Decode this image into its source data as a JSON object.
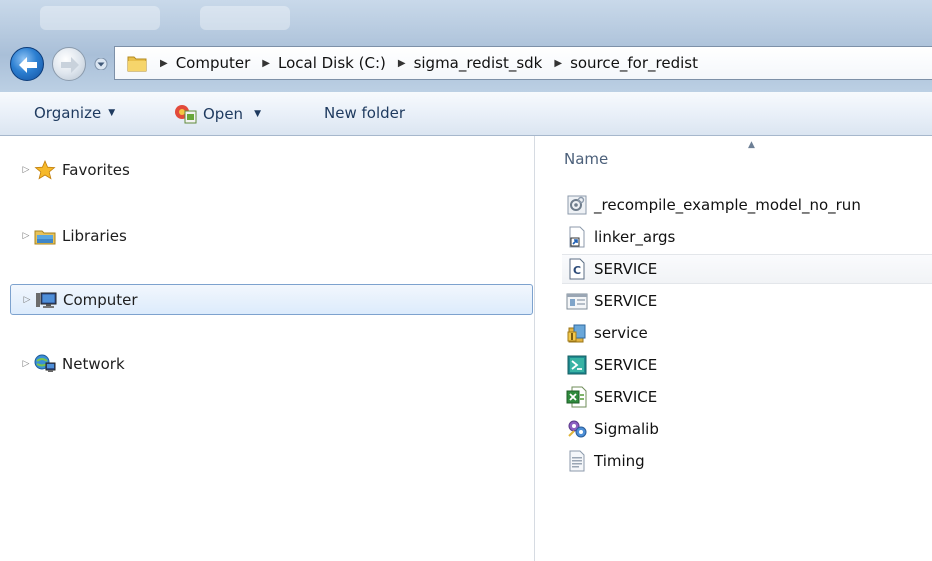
{
  "address_bar": {
    "breadcrumbs": [
      "Computer",
      "Local Disk (C:)",
      "sigma_redist_sdk",
      "source_for_redist"
    ]
  },
  "toolbar": {
    "organize_label": "Organize",
    "open_label": "Open",
    "new_folder_label": "New folder"
  },
  "nav_pane": {
    "items": [
      {
        "label": "Favorites",
        "icon": "star-icon"
      },
      {
        "label": "Libraries",
        "icon": "libraries-icon"
      },
      {
        "label": "Computer",
        "icon": "computer-icon",
        "selected": true
      },
      {
        "label": "Network",
        "icon": "network-icon"
      }
    ]
  },
  "file_list": {
    "column_name": "Name",
    "files": [
      {
        "name": "_recompile_example_model_no_run",
        "icon": "batch-file-icon"
      },
      {
        "name": "linker_args",
        "icon": "shortcut-file-icon"
      },
      {
        "name": "SERVICE",
        "icon": "c-source-file-icon",
        "highlighted": true
      },
      {
        "name": "SERVICE",
        "icon": "window-file-icon"
      },
      {
        "name": "service",
        "icon": "archive-file-icon"
      },
      {
        "name": "SERVICE",
        "icon": "executable-file-icon"
      },
      {
        "name": "SERVICE",
        "icon": "spreadsheet-file-icon"
      },
      {
        "name": "Sigmalib",
        "icon": "library-file-icon"
      },
      {
        "name": "Timing",
        "icon": "text-file-icon"
      }
    ]
  },
  "colors": {
    "selection_border": "#7da2ce",
    "selection_fill": "#dcebfc",
    "toolbar_text": "#1e3a5f"
  }
}
